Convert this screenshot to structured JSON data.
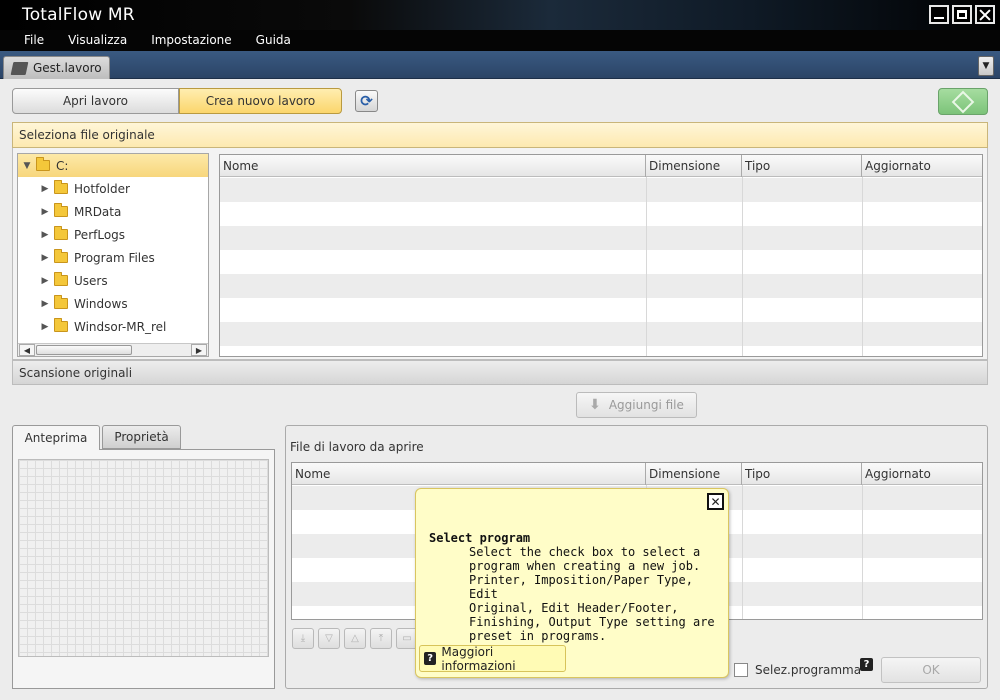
{
  "window": {
    "title": "TotalFlow MR"
  },
  "menu": {
    "items": [
      "File",
      "Visualizza",
      "Impostazione",
      "Guida"
    ]
  },
  "tabs": {
    "main": "Gest.lavoro",
    "dropdown_symbol": "▼"
  },
  "toolbar": {
    "open_job": "Apri lavoro",
    "create_job": "Crea nuovo lavoro"
  },
  "select_original": {
    "header": "Seleziona file originale",
    "tree": [
      {
        "label": "C:",
        "expanded": true,
        "selected": true,
        "level": 0
      },
      {
        "label": "Hotfolder",
        "level": 1
      },
      {
        "label": "MRData",
        "level": 1
      },
      {
        "label": "PerfLogs",
        "level": 1
      },
      {
        "label": "Program Files",
        "level": 1
      },
      {
        "label": "Users",
        "level": 1
      },
      {
        "label": "Windows",
        "level": 1
      },
      {
        "label": "Windsor-MR_rel",
        "level": 1
      }
    ],
    "columns": [
      "Nome",
      "Dimensione",
      "Tipo",
      "Aggiornato"
    ]
  },
  "scan": {
    "header": "Scansione originali"
  },
  "add_file": {
    "label": "Aggiungi file"
  },
  "preview": {
    "tabs": [
      "Anteprima",
      "Proprietà"
    ]
  },
  "job_files": {
    "title": "File di lavoro da aprire",
    "columns": [
      "Nome",
      "Dimensione",
      "Tipo",
      "Aggiornato"
    ]
  },
  "select_program": {
    "checkbox_label": "Selez.programma",
    "checked": false
  },
  "ok_button": "OK",
  "tooltip": {
    "title": "Select program",
    "body": "Select the check box to select a\nprogram when creating a new job.\nPrinter, Imposition/Paper Type, Edit\nOriginal, Edit Header/Footer,\nFinishing, Output Type setting are\npreset in programs.",
    "more_info": "Maggiori informazioni"
  },
  "colors": {
    "accent_yellow": "#fbd66c",
    "start_green": "#7cc379",
    "menu_bg": "#050505"
  }
}
